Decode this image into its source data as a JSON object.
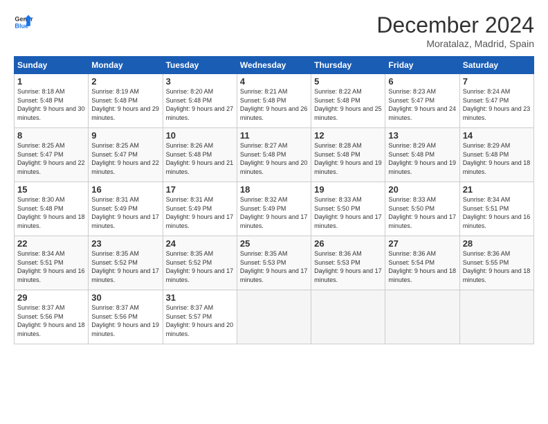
{
  "logo": {
    "line1": "General",
    "line2": "Blue"
  },
  "title": "December 2024",
  "location": "Moratalaz, Madrid, Spain",
  "days_of_week": [
    "Sunday",
    "Monday",
    "Tuesday",
    "Wednesday",
    "Thursday",
    "Friday",
    "Saturday"
  ],
  "weeks": [
    [
      {
        "day": 1,
        "sunrise": "8:18 AM",
        "sunset": "5:48 PM",
        "daylight": "9 hours and 30 minutes."
      },
      {
        "day": 2,
        "sunrise": "8:19 AM",
        "sunset": "5:48 PM",
        "daylight": "9 hours and 29 minutes."
      },
      {
        "day": 3,
        "sunrise": "8:20 AM",
        "sunset": "5:48 PM",
        "daylight": "9 hours and 27 minutes."
      },
      {
        "day": 4,
        "sunrise": "8:21 AM",
        "sunset": "5:48 PM",
        "daylight": "9 hours and 26 minutes."
      },
      {
        "day": 5,
        "sunrise": "8:22 AM",
        "sunset": "5:48 PM",
        "daylight": "9 hours and 25 minutes."
      },
      {
        "day": 6,
        "sunrise": "8:23 AM",
        "sunset": "5:47 PM",
        "daylight": "9 hours and 24 minutes."
      },
      {
        "day": 7,
        "sunrise": "8:24 AM",
        "sunset": "5:47 PM",
        "daylight": "9 hours and 23 minutes."
      }
    ],
    [
      {
        "day": 8,
        "sunrise": "8:25 AM",
        "sunset": "5:47 PM",
        "daylight": "9 hours and 22 minutes."
      },
      {
        "day": 9,
        "sunrise": "8:25 AM",
        "sunset": "5:47 PM",
        "daylight": "9 hours and 22 minutes."
      },
      {
        "day": 10,
        "sunrise": "8:26 AM",
        "sunset": "5:48 PM",
        "daylight": "9 hours and 21 minutes."
      },
      {
        "day": 11,
        "sunrise": "8:27 AM",
        "sunset": "5:48 PM",
        "daylight": "9 hours and 20 minutes."
      },
      {
        "day": 12,
        "sunrise": "8:28 AM",
        "sunset": "5:48 PM",
        "daylight": "9 hours and 19 minutes."
      },
      {
        "day": 13,
        "sunrise": "8:29 AM",
        "sunset": "5:48 PM",
        "daylight": "9 hours and 19 minutes."
      },
      {
        "day": 14,
        "sunrise": "8:29 AM",
        "sunset": "5:48 PM",
        "daylight": "9 hours and 18 minutes."
      }
    ],
    [
      {
        "day": 15,
        "sunrise": "8:30 AM",
        "sunset": "5:48 PM",
        "daylight": "9 hours and 18 minutes."
      },
      {
        "day": 16,
        "sunrise": "8:31 AM",
        "sunset": "5:49 PM",
        "daylight": "9 hours and 17 minutes."
      },
      {
        "day": 17,
        "sunrise": "8:31 AM",
        "sunset": "5:49 PM",
        "daylight": "9 hours and 17 minutes."
      },
      {
        "day": 18,
        "sunrise": "8:32 AM",
        "sunset": "5:49 PM",
        "daylight": "9 hours and 17 minutes."
      },
      {
        "day": 19,
        "sunrise": "8:33 AM",
        "sunset": "5:50 PM",
        "daylight": "9 hours and 17 minutes."
      },
      {
        "day": 20,
        "sunrise": "8:33 AM",
        "sunset": "5:50 PM",
        "daylight": "9 hours and 17 minutes."
      },
      {
        "day": 21,
        "sunrise": "8:34 AM",
        "sunset": "5:51 PM",
        "daylight": "9 hours and 16 minutes."
      }
    ],
    [
      {
        "day": 22,
        "sunrise": "8:34 AM",
        "sunset": "5:51 PM",
        "daylight": "9 hours and 16 minutes."
      },
      {
        "day": 23,
        "sunrise": "8:35 AM",
        "sunset": "5:52 PM",
        "daylight": "9 hours and 17 minutes."
      },
      {
        "day": 24,
        "sunrise": "8:35 AM",
        "sunset": "5:52 PM",
        "daylight": "9 hours and 17 minutes."
      },
      {
        "day": 25,
        "sunrise": "8:35 AM",
        "sunset": "5:53 PM",
        "daylight": "9 hours and 17 minutes."
      },
      {
        "day": 26,
        "sunrise": "8:36 AM",
        "sunset": "5:53 PM",
        "daylight": "9 hours and 17 minutes."
      },
      {
        "day": 27,
        "sunrise": "8:36 AM",
        "sunset": "5:54 PM",
        "daylight": "9 hours and 18 minutes."
      },
      {
        "day": 28,
        "sunrise": "8:36 AM",
        "sunset": "5:55 PM",
        "daylight": "9 hours and 18 minutes."
      }
    ],
    [
      {
        "day": 29,
        "sunrise": "8:37 AM",
        "sunset": "5:56 PM",
        "daylight": "9 hours and 18 minutes."
      },
      {
        "day": 30,
        "sunrise": "8:37 AM",
        "sunset": "5:56 PM",
        "daylight": "9 hours and 19 minutes."
      },
      {
        "day": 31,
        "sunrise": "8:37 AM",
        "sunset": "5:57 PM",
        "daylight": "9 hours and 20 minutes."
      },
      null,
      null,
      null,
      null
    ]
  ],
  "labels": {
    "sunrise": "Sunrise:",
    "sunset": "Sunset:",
    "daylight": "Daylight:"
  }
}
